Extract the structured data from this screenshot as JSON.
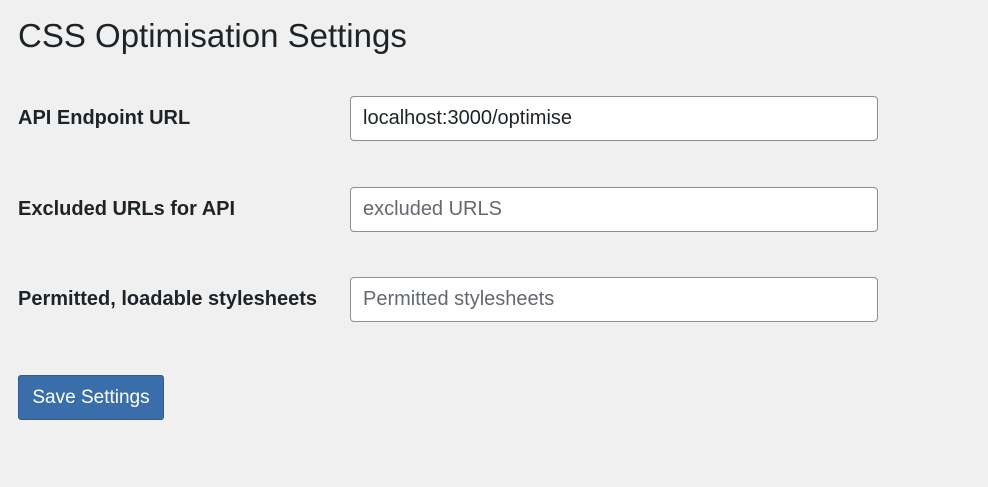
{
  "page": {
    "title": "CSS Optimisation Settings"
  },
  "fields": {
    "api_endpoint": {
      "label": "API Endpoint URL",
      "value": "localhost:3000/optimise",
      "placeholder": ""
    },
    "excluded_urls": {
      "label": "Excluded URLs for API",
      "value": "",
      "placeholder": "excluded URLS"
    },
    "permitted_stylesheets": {
      "label": "Permitted, loadable stylesheets",
      "value": "",
      "placeholder": "Permitted stylesheets"
    }
  },
  "actions": {
    "save_label": "Save Settings"
  },
  "colors": {
    "background": "#f0f0f1",
    "primary_button": "#3a6eab",
    "input_border": "#8c8f94",
    "text": "#1d2327",
    "placeholder": "#646970"
  }
}
